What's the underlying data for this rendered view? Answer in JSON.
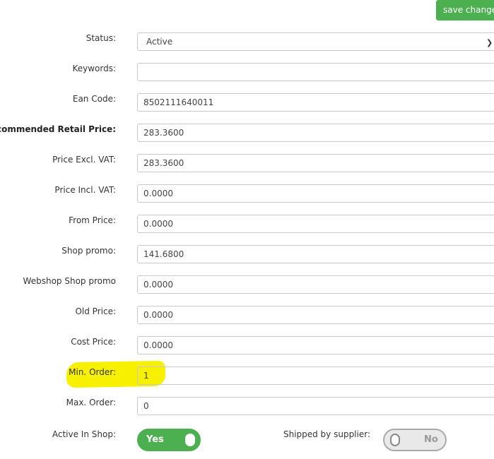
{
  "toolbar": {
    "save_label": "save changes"
  },
  "fields": [
    {
      "label": "Status:",
      "value": "Active"
    },
    {
      "label": "Keywords:",
      "value": ""
    },
    {
      "label": "Ean Code:",
      "value": "8502111640011"
    },
    {
      "label": "Recommended Retail Price:",
      "value": "283.3600"
    },
    {
      "label": "Price Excl. VAT:",
      "value": "283.3600"
    },
    {
      "label": "Price Incl. VAT:",
      "value": "0.0000"
    },
    {
      "label": "From Price:",
      "value": "0.0000"
    },
    {
      "label": "Shop promo:",
      "value": "141.6800"
    },
    {
      "label": "Webshop Shop promo",
      "value": "0.0000"
    },
    {
      "label": "Old Price:",
      "value": "0.0000"
    },
    {
      "label": "Cost Price:",
      "value": "0.0000"
    },
    {
      "label": "Min. Order:",
      "value": "1"
    },
    {
      "label": "Max. Order:",
      "value": "0"
    }
  ],
  "toggles": {
    "active_in_shop": {
      "label": "Active In Shop:",
      "state_text": "Yes",
      "on": true
    },
    "shipped_by_supplier": {
      "label": "Shipped by supplier:",
      "state_text": "No",
      "on": false
    }
  },
  "colors": {
    "accent": "#4caf50",
    "highlight": "#f7f000"
  },
  "icons": {
    "status_select": "chevron-down-icon"
  }
}
